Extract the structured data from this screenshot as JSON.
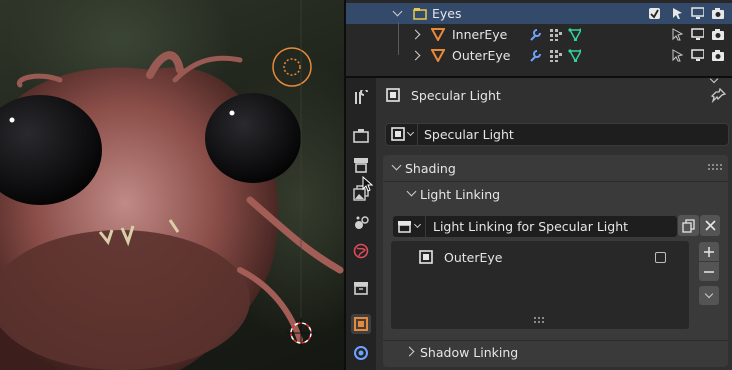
{
  "outliner": {
    "collection_label": "Eyes",
    "items": [
      {
        "label": "InnerEye"
      },
      {
        "label": "OuterEye"
      }
    ]
  },
  "properties": {
    "object_name": "Specular Light",
    "datablock_name": "Specular Light",
    "sections": {
      "shading": "Shading",
      "light_linking": "Light Linking",
      "shadow_linking": "Shadow Linking"
    },
    "light_linking": {
      "collection_name": "Light Linking for Specular Light",
      "items": [
        {
          "label": "OuterEye",
          "checked": false
        }
      ]
    }
  },
  "colors": {
    "accent_orange": "#e8893a",
    "selection_blue": "#334a6b",
    "mesh_green": "#33d39e",
    "wrench_blue": "#6fa2ff"
  }
}
